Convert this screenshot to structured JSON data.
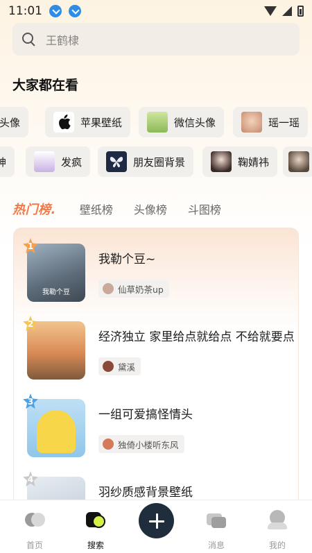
{
  "status_bar": {
    "time": "11:01"
  },
  "search": {
    "placeholder": "王鹤棣"
  },
  "section": {
    "title": "大家都在看"
  },
  "chips_row1": [
    {
      "label": "情侣头像",
      "display": "侣头像",
      "icon": "couple-avatar-thumb",
      "color": "#d9c6b5"
    },
    {
      "label": "苹果壁纸",
      "icon": "apple-logo-thumb",
      "color": "#ffffff"
    },
    {
      "label": "微信头像",
      "icon": "wechat-avatar-thumb",
      "color": "#a7c96e"
    },
    {
      "label": "瑶一瑶",
      "icon": "girl-avatar-thumb",
      "color": "#e8c0a8"
    }
  ],
  "chips_row2": [
    {
      "label": "神",
      "icon": "partial-thumb",
      "color": "#e0e0e0"
    },
    {
      "label": "发疯",
      "icon": "crazy-meme-thumb",
      "color": "#b596d6"
    },
    {
      "label": "朋友圈背景",
      "icon": "butterfly-thumb",
      "color": "#1e2a44"
    },
    {
      "label": "鞠婧祎",
      "icon": "actress-thumb",
      "color": "#e6d3c8"
    },
    {
      "label": "",
      "icon": "portrait-thumb",
      "color": "#c9b9a8"
    }
  ],
  "tabs": {
    "hot_logo": "热门榜.",
    "items": [
      "壁纸榜",
      "头像榜",
      "斗图榜"
    ]
  },
  "rank_list": [
    {
      "rank": "1",
      "title": "我勒个豆~",
      "author": "仙草奶茶up",
      "thumb_caption": "我勒个豆",
      "badge_color": "#f5a04a",
      "thumb_color": "#6b7c8c",
      "avatar_color": "#c9a99a"
    },
    {
      "rank": "2",
      "title": "经济独立 家里给点就给点 不给就要点",
      "author": "黛溪",
      "thumb_caption": "",
      "badge_color": "#f6c451",
      "thumb_color": "#e3a063",
      "avatar_color": "#8a4a3a"
    },
    {
      "rank": "3",
      "title": "一组可爱搞怪情头",
      "author": "独倚小楼听东风",
      "thumb_caption": "",
      "badge_color": "#4aa3e6",
      "thumb_color": "#8fc6ea",
      "avatar_color": "#d47a5a"
    },
    {
      "rank": "4",
      "title": "羽纱质感背景壁纸",
      "author": "",
      "thumb_caption": "",
      "badge_color": "#c9c9c9",
      "thumb_color": "#cfd6de",
      "avatar_color": "#cccccc"
    }
  ],
  "bottom_nav": {
    "home": "首页",
    "search": "搜索",
    "messages": "消息",
    "profile": "我的"
  }
}
